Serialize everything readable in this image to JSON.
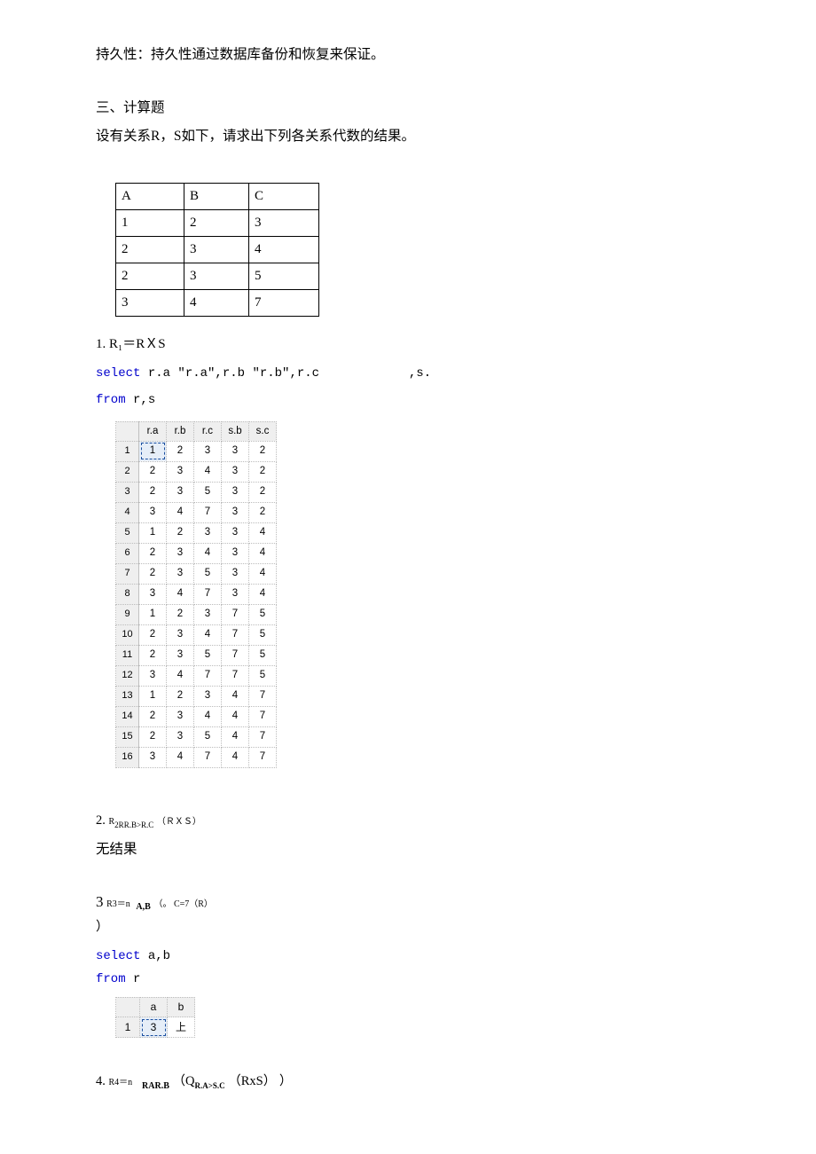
{
  "top_paragraph": "持久性：持久性通过数据库备份和恢复来保证。",
  "section_heading": "三、计算题",
  "section_intro": "设有关系R，S如下，请求出下列各关系代数的结果。",
  "table_R": {
    "headers": [
      "A",
      "B",
      "C"
    ],
    "rows": [
      [
        "1",
        "2",
        "3"
      ],
      [
        "2",
        "3",
        "4"
      ],
      [
        "2",
        "3",
        "5"
      ],
      [
        "3",
        "4",
        "7"
      ]
    ]
  },
  "prob1": {
    "index": "1.",
    "formula": "R₁＝RＸS"
  },
  "code1": {
    "line1_select": "select",
    "line1_rest": " r.a \"r.a\",r.b \"r.b\",r.c            ,s.",
    "line2_from": "from",
    "line2_rest": " r,s"
  },
  "result1": {
    "headers": [
      "r.a",
      "r.b",
      "r.c",
      "s.b",
      "s.c"
    ],
    "rows": [
      [
        "1",
        "1",
        "2",
        "3",
        "3",
        "2"
      ],
      [
        "2",
        "2",
        "3",
        "4",
        "3",
        "2"
      ],
      [
        "3",
        "2",
        "3",
        "5",
        "3",
        "2"
      ],
      [
        "4",
        "3",
        "4",
        "7",
        "3",
        "2"
      ],
      [
        "5",
        "1",
        "2",
        "3",
        "3",
        "4"
      ],
      [
        "6",
        "2",
        "3",
        "4",
        "3",
        "4"
      ],
      [
        "7",
        "2",
        "3",
        "5",
        "3",
        "4"
      ],
      [
        "8",
        "3",
        "4",
        "7",
        "3",
        "4"
      ],
      [
        "9",
        "1",
        "2",
        "3",
        "7",
        "5"
      ],
      [
        "10",
        "2",
        "3",
        "4",
        "7",
        "5"
      ],
      [
        "11",
        "2",
        "3",
        "5",
        "7",
        "5"
      ],
      [
        "12",
        "3",
        "4",
        "7",
        "7",
        "5"
      ],
      [
        "13",
        "1",
        "2",
        "3",
        "4",
        "7"
      ],
      [
        "14",
        "2",
        "3",
        "4",
        "4",
        "7"
      ],
      [
        "15",
        "2",
        "3",
        "5",
        "4",
        "7"
      ],
      [
        "16",
        "3",
        "4",
        "7",
        "4",
        "7"
      ]
    ]
  },
  "prob2": {
    "index": "2.",
    "prefix": "R",
    "sub": "2R",
    "cond": "R.B>R.C",
    "tail": "（ＲＸＳ）"
  },
  "prob2_result": "无结果",
  "prob3": {
    "index": "3",
    "prefix": "R3",
    "eq": "＝n",
    "proj": "A,B",
    "sigma": "（。 C=7（R）",
    "close": "）"
  },
  "code3": {
    "line1_select": "select",
    "line1_rest": " a,b",
    "line2_from": "from",
    "line2_rest": " r"
  },
  "result3": {
    "headers": [
      "a",
      "b"
    ],
    "rows": [
      [
        "1",
        "3",
        "上"
      ]
    ]
  },
  "prob4": {
    "index": "4.",
    "prefix": "R4",
    "eq": "＝n",
    "proj": "RAR.B",
    "sigma_q": "Q",
    "sigma_cond": "R.A>S.C",
    "body": "（RxS）",
    "close": "）"
  }
}
